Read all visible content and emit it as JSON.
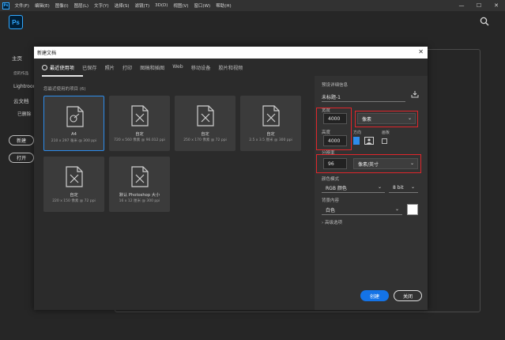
{
  "menubar": {
    "app_badge": "Ps",
    "items": [
      "文件(F)",
      "编辑(E)",
      "图像(I)",
      "图层(L)",
      "文字(Y)",
      "选择(S)",
      "滤镜(T)",
      "3D(D)",
      "视图(V)",
      "窗口(W)",
      "帮助(H)"
    ],
    "window_controls": [
      "—",
      "☐",
      "✕"
    ]
  },
  "app": {
    "logo": "Ps"
  },
  "home": {
    "nav": [
      "主页",
      "您的作品",
      "Lightroom",
      "云文档",
      "已删除"
    ],
    "new_button": "新建",
    "open_button": "打开"
  },
  "dialog": {
    "title": "新建文档",
    "close": "✕",
    "tabs": [
      "最近使用项",
      "已保存",
      "照片",
      "打印",
      "图稿和插图",
      "Web",
      "移动设备",
      "胶片和视频"
    ],
    "recent_label": "您最近使用的项目 (6)",
    "presets": [
      {
        "name": "A4",
        "desc": "210 x 297 毫米 @ 300 ppi"
      },
      {
        "name": "自定",
        "desc": "720 x 560 像素 @ 96.012 ppi"
      },
      {
        "name": "自定",
        "desc": "250 x 170 像素 @ 72 ppi"
      },
      {
        "name": "自定",
        "desc": "2.5 x 3.5 厘米 @ 300 ppi"
      },
      {
        "name": "自定",
        "desc": "220 x 150 像素 @ 72 ppi"
      },
      {
        "name": "默认 Photoshop 大小",
        "desc": "16 x 12 厘米 @ 300 ppi"
      }
    ],
    "details": {
      "section_label": "预设详细信息",
      "doc_name": "未标题-1",
      "width_label": "宽度",
      "width_value": "4000",
      "unit_value": "像素",
      "height_label": "高度",
      "height_value": "4000",
      "orientation_label": "方向",
      "artboard_label": "画板",
      "resolution_label": "分辨率",
      "resolution_value": "96",
      "resolution_unit": "像素/英寸",
      "color_mode_label": "颜色模式",
      "color_mode_value": "RGB 颜色",
      "bit_depth": "8 bit",
      "background_label": "背景内容",
      "background_value": "白色",
      "advanced": "高级选项"
    },
    "create_button": "创建",
    "close_button": "关闭"
  },
  "colors": {
    "accent": "#1473e6",
    "highlight": "#e0262b",
    "selected_border": "#2d8ceb"
  }
}
